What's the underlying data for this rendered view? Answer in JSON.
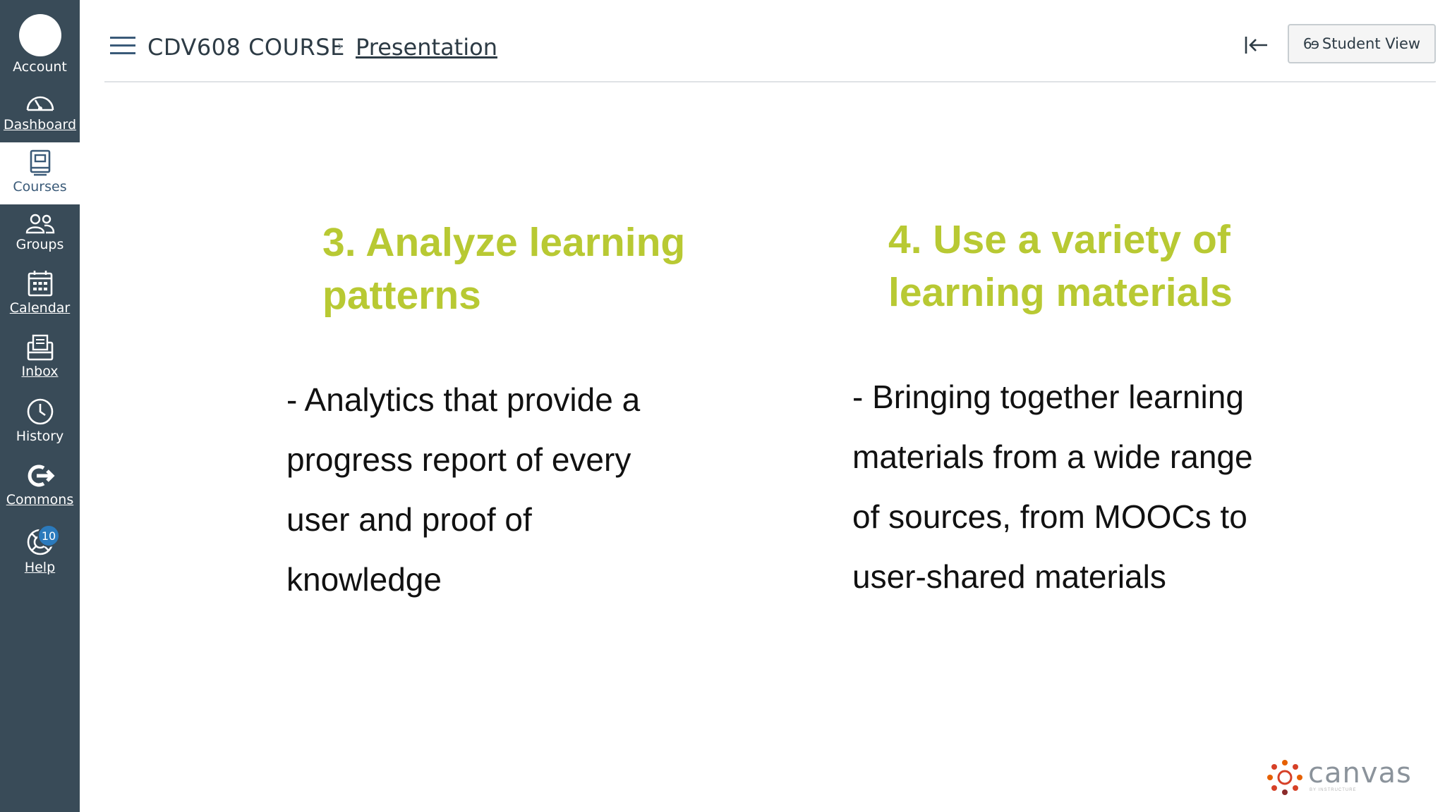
{
  "nav": {
    "items": [
      {
        "id": "account",
        "label": "Account"
      },
      {
        "id": "dashboard",
        "label": "Dashboard"
      },
      {
        "id": "courses",
        "label": "Courses"
      },
      {
        "id": "groups",
        "label": "Groups"
      },
      {
        "id": "calendar",
        "label": "Calendar"
      },
      {
        "id": "inbox",
        "label": "Inbox"
      },
      {
        "id": "history",
        "label": "History"
      },
      {
        "id": "commons",
        "label": "Commons"
      },
      {
        "id": "help",
        "label": "Help",
        "badge": "10"
      }
    ],
    "active": "courses",
    "background_color": "#394b58"
  },
  "header": {
    "course_name": "CDV608 COURSE",
    "breadcrumb_separator": "›",
    "page_name": "Presentation",
    "student_view_label": "Student View",
    "student_view_icon": "glasses-icon"
  },
  "slide": {
    "accent_color": "#b8c933",
    "columns": [
      {
        "heading_lines": [
          "3. Analyze learning",
          "patterns"
        ],
        "body_lines": [
          "- Analytics that provide a",
          "progress report of every",
          "user and proof of",
          "knowledge"
        ]
      },
      {
        "heading_lines": [
          "4. Use a variety of",
          "learning materials"
        ],
        "body_lines": [
          "- Bringing together learning",
          "materials from a wide range",
          "of sources, from MOOCs to",
          "user-shared materials"
        ]
      }
    ]
  },
  "logo": {
    "wordmark": "canvas",
    "tagline": "BY INSTRUCTURE"
  }
}
